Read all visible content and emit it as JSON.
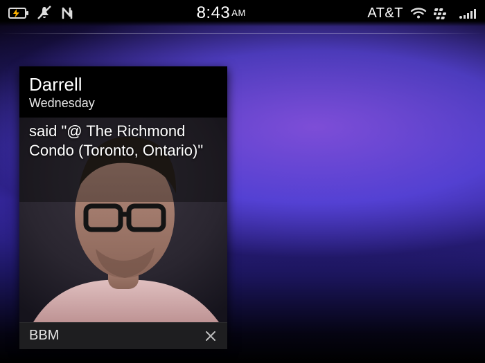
{
  "status": {
    "time": "8:43",
    "ampm": "AM",
    "carrier": "AT&T",
    "icons": {
      "battery": "battery-charging-icon",
      "mute": "mute-icon",
      "nfc": "nfc-icon",
      "wifi": "wifi-icon",
      "bb": "blackberry-icon",
      "signal": "signal-icon"
    }
  },
  "notification": {
    "sender": "Darrell",
    "day": "Wednesday",
    "message": "said \"@ The Richmond Condo (Toronto, Ontario)\"",
    "app": "BBM",
    "avatar": "contact-avatar"
  }
}
